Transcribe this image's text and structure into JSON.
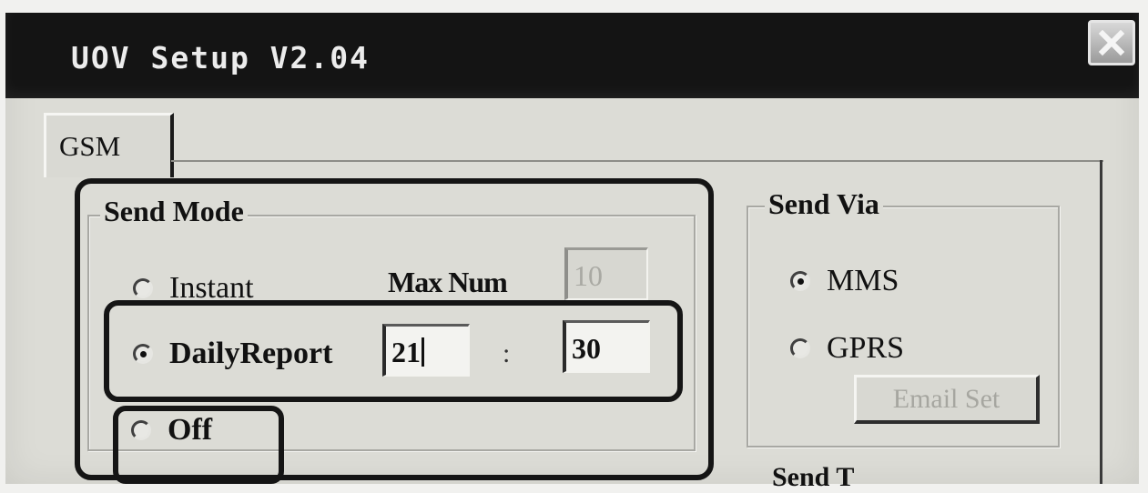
{
  "window": {
    "title": "UOV Setup V2.04"
  },
  "tabs": [
    {
      "label": "GSM"
    }
  ],
  "send_mode": {
    "legend": "Send Mode",
    "options": [
      {
        "label": "Instant",
        "checked": false
      },
      {
        "label": "DailyReport",
        "checked": true
      },
      {
        "label": "Off",
        "checked": false
      }
    ],
    "max_num_label": "Max Num",
    "max_num_value": "10",
    "hour_value": "21",
    "colon": ":",
    "minute_value": "30"
  },
  "send_via": {
    "legend": "Send Via",
    "options": [
      {
        "label": "MMS",
        "checked": true
      },
      {
        "label": "GPRS",
        "checked": false
      }
    ],
    "email_button": "Email Set"
  },
  "partial_label": "Send T"
}
